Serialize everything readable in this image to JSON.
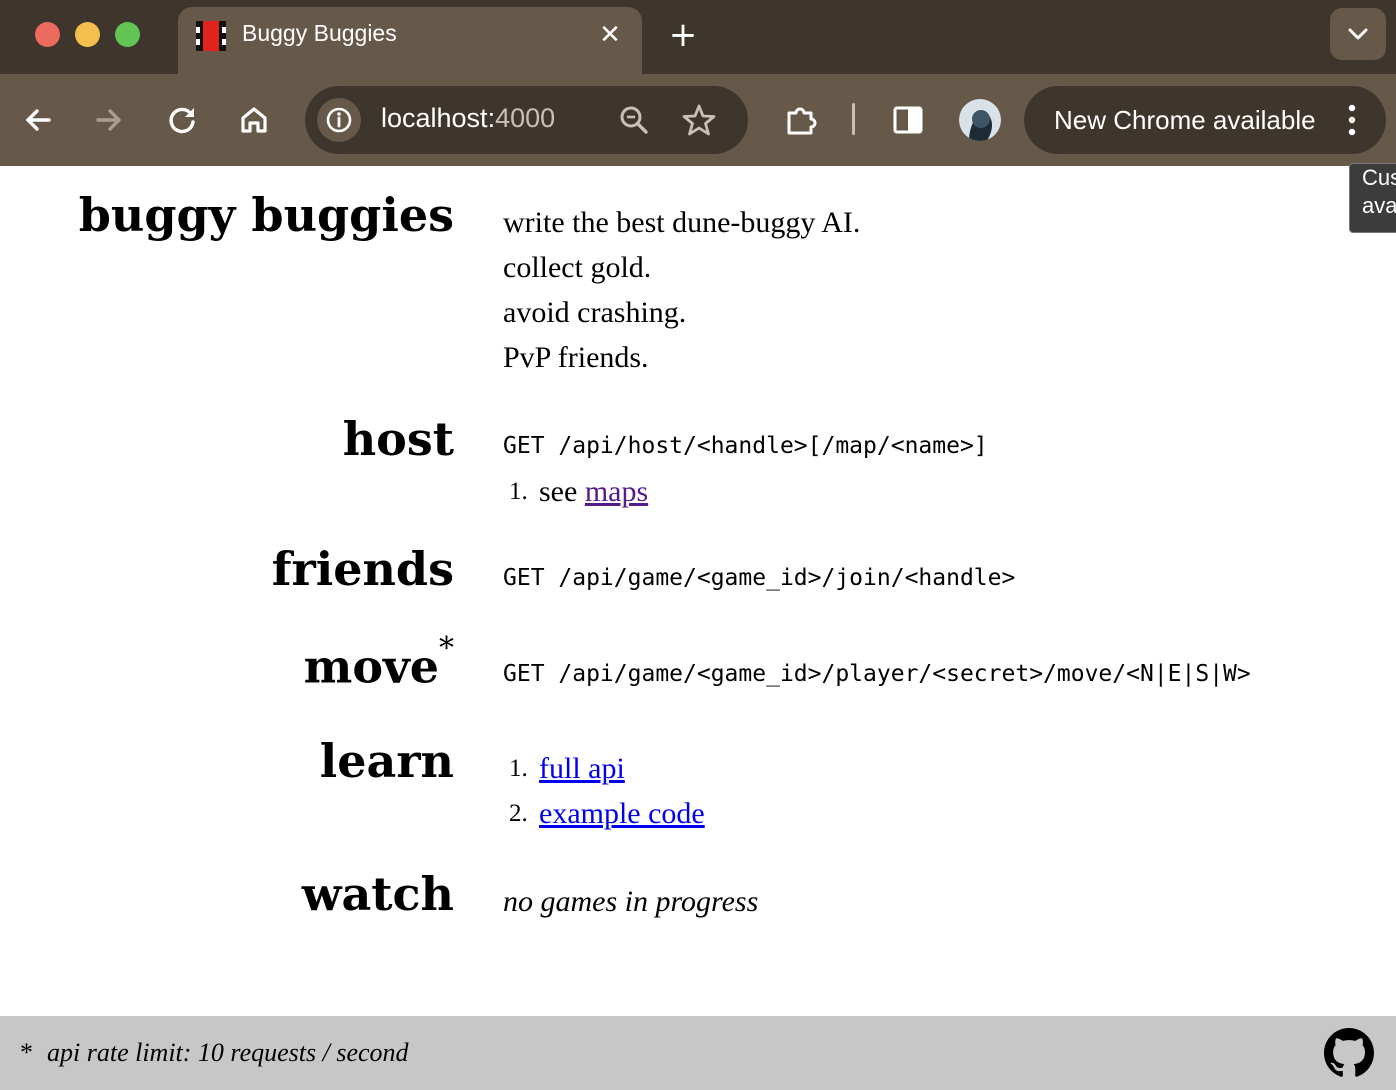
{
  "browser": {
    "tab_title": "Buggy Buggies",
    "tab_close": "✕",
    "new_tab": "+",
    "url_host": "localhost:",
    "url_port": "4000",
    "update_label": "New Chrome available",
    "tooltip_line1": "Cus",
    "tooltip_line2": "ava"
  },
  "sections": {
    "intro": {
      "heading": "buggy buggies",
      "lines": [
        "write the best dune-buggy AI.",
        "collect gold.",
        "avoid crashing.",
        "PvP friends."
      ]
    },
    "host": {
      "heading": "host",
      "endpoint": "GET /api/host/<handle>[/map/<name>]",
      "item_num": "1.",
      "item_prefix": "see",
      "item_link": "maps"
    },
    "friends": {
      "heading": "friends",
      "endpoint": "GET /api/game/<game_id>/join/<handle>"
    },
    "move": {
      "heading": "move",
      "marker": "*",
      "endpoint": "GET /api/game/<game_id>/player/<secret>/move/<N|E|S|W>"
    },
    "learn": {
      "heading": "learn",
      "items": [
        {
          "num": "1.",
          "label": "full api"
        },
        {
          "num": "2.",
          "label": "example code"
        }
      ]
    },
    "watch": {
      "heading": "watch",
      "status": "no games in progress"
    }
  },
  "footer": {
    "marker": "*",
    "note": "api rate limit: 10 requests / second"
  },
  "icons": {
    "github": "github-icon",
    "favicon": "buggy-favicon"
  }
}
